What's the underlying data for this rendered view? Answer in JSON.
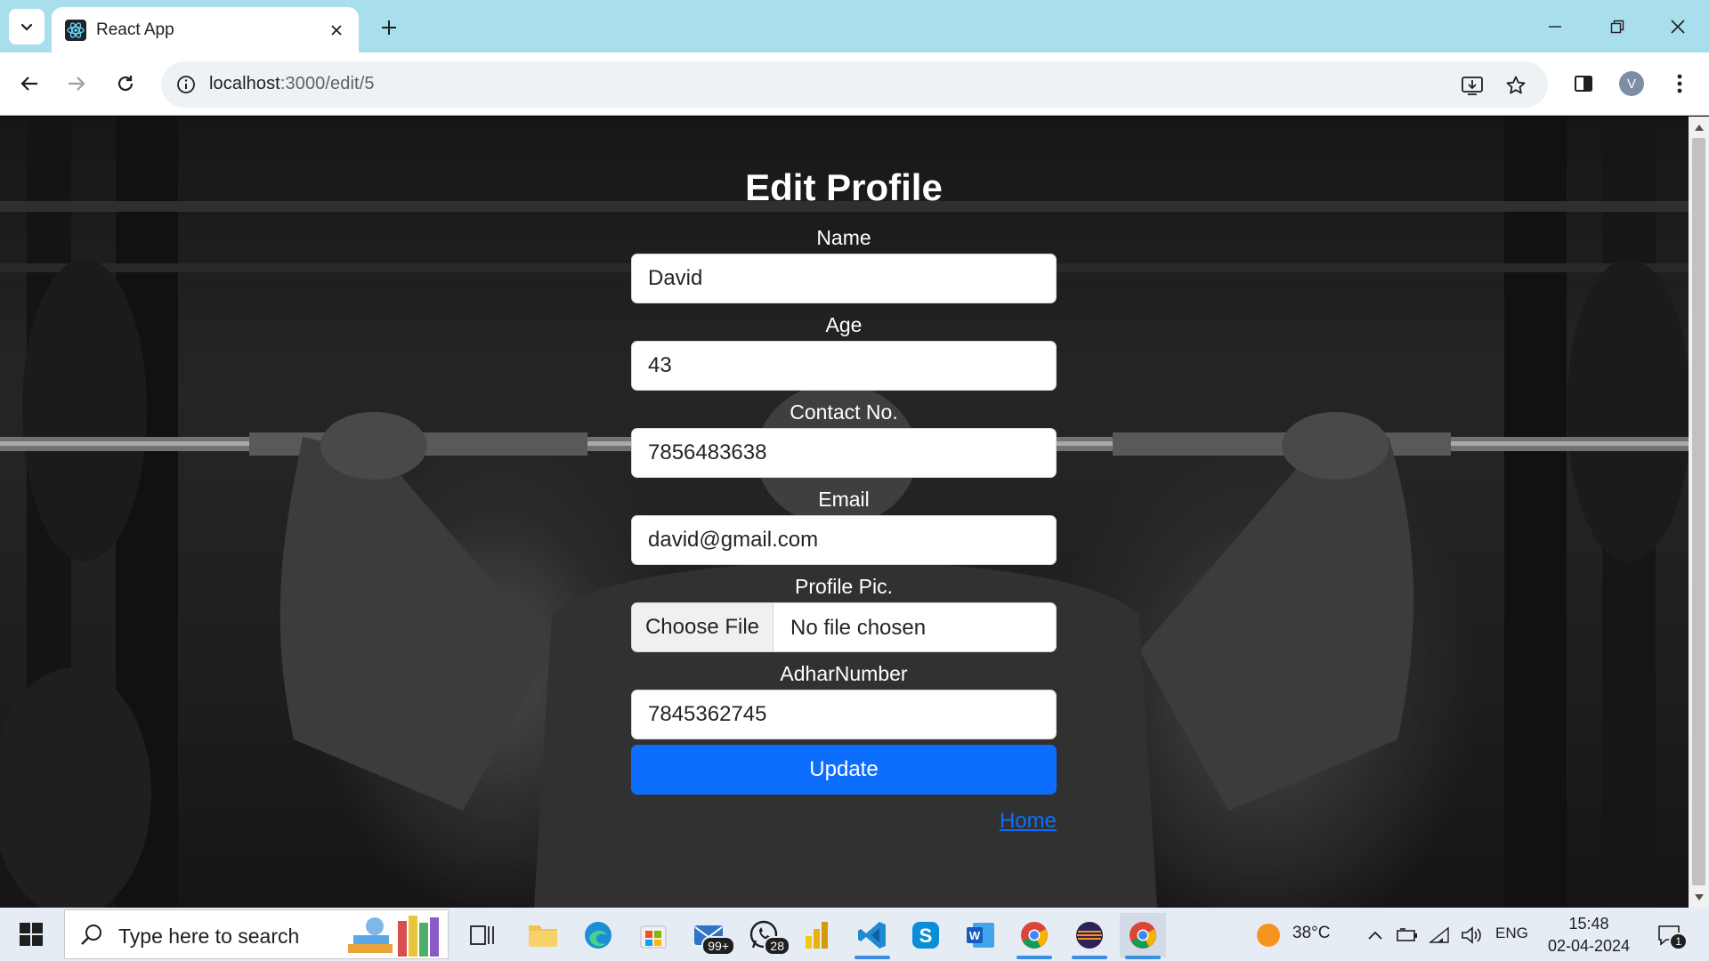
{
  "browser": {
    "tab_title": "React App",
    "url_host": "localhost",
    "url_path": ":3000/edit/5",
    "profile_initial": "V"
  },
  "page": {
    "title": "Edit Profile",
    "fields": {
      "name": {
        "label": "Name",
        "value": "David"
      },
      "age": {
        "label": "Age",
        "value": "43"
      },
      "contact": {
        "label": "Contact No.",
        "value": "7856483638"
      },
      "email": {
        "label": "Email",
        "value": "david@gmail.com"
      },
      "profile_pic": {
        "label": "Profile Pic.",
        "button": "Choose File",
        "status": "No file chosen"
      },
      "adhar": {
        "label": "AdharNumber",
        "value": "7845362745"
      }
    },
    "update_label": "Update",
    "home_label": "Home"
  },
  "taskbar": {
    "search_placeholder": "Type here to search",
    "mail_badge": "99+",
    "whatsapp_badge": "28",
    "weather": "38°C",
    "language": "ENG",
    "time": "15:48",
    "date": "02-04-2024",
    "notification_count": "1"
  },
  "colors": {
    "tabbar": "#a9dfec",
    "primary": "#0d6efd",
    "taskbar": "#e6ecf4"
  }
}
